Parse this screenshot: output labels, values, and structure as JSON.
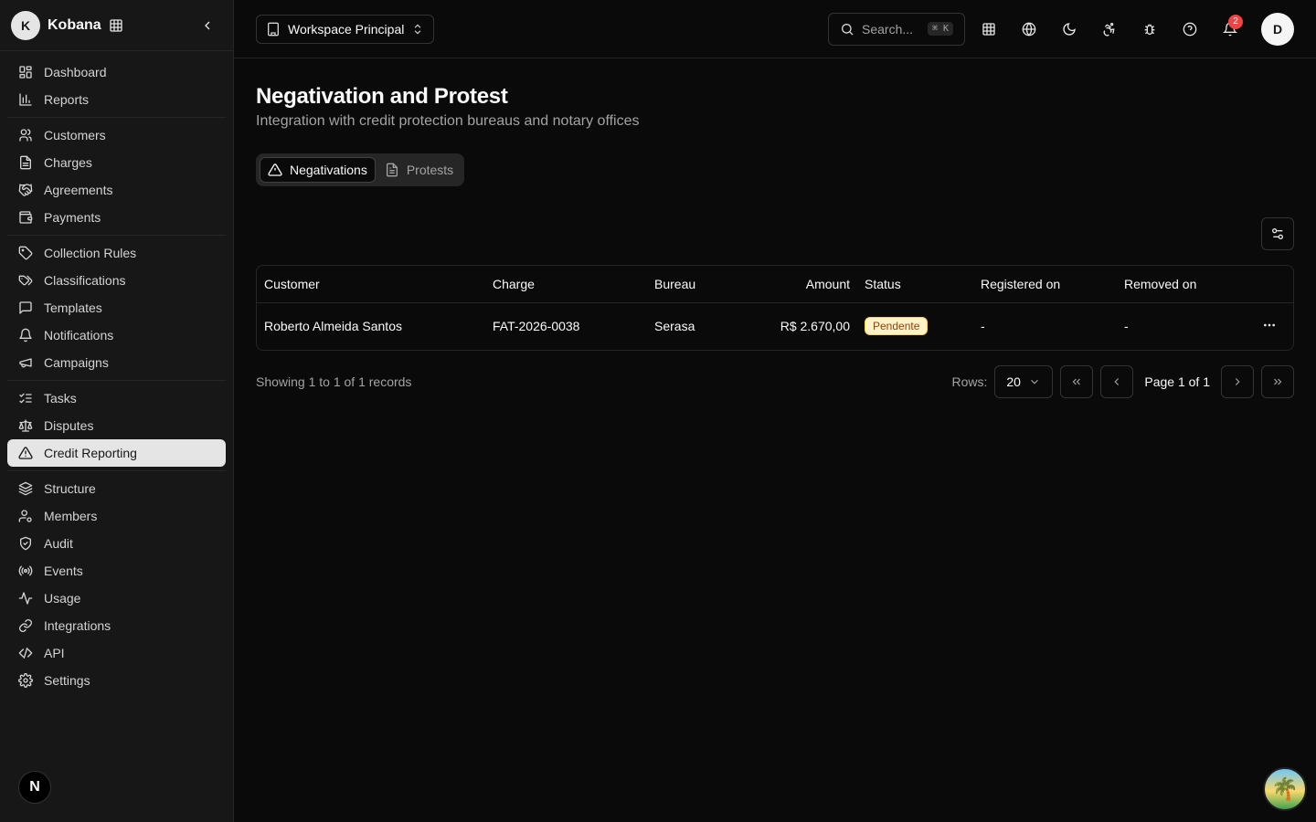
{
  "brand": {
    "initial": "K",
    "name": "Kobana"
  },
  "sidebar": {
    "groups": [
      [
        {
          "label": "Dashboard",
          "icon": "dashboard-icon"
        },
        {
          "label": "Reports",
          "icon": "bar-chart-icon"
        }
      ],
      [
        {
          "label": "Customers",
          "icon": "users-icon"
        },
        {
          "label": "Charges",
          "icon": "file-icon"
        },
        {
          "label": "Agreements",
          "icon": "handshake-icon"
        },
        {
          "label": "Payments",
          "icon": "wallet-icon"
        }
      ],
      [
        {
          "label": "Collection Rules",
          "icon": "tag-icon"
        },
        {
          "label": "Classifications",
          "icon": "tags-icon"
        },
        {
          "label": "Templates",
          "icon": "message-icon"
        },
        {
          "label": "Notifications",
          "icon": "bell-icon"
        },
        {
          "label": "Campaigns",
          "icon": "megaphone-icon"
        }
      ],
      [
        {
          "label": "Tasks",
          "icon": "list-checks-icon"
        },
        {
          "label": "Disputes",
          "icon": "scale-icon"
        },
        {
          "label": "Credit Reporting",
          "icon": "alert-triangle-icon",
          "active": true
        }
      ],
      [
        {
          "label": "Structure",
          "icon": "layers-icon"
        },
        {
          "label": "Members",
          "icon": "user-cog-icon"
        },
        {
          "label": "Audit",
          "icon": "shield-icon"
        },
        {
          "label": "Events",
          "icon": "radio-icon"
        },
        {
          "label": "Usage",
          "icon": "activity-icon"
        },
        {
          "label": "Integrations",
          "icon": "link-icon"
        },
        {
          "label": "API",
          "icon": "code-icon"
        },
        {
          "label": "Settings",
          "icon": "gear-icon"
        }
      ]
    ],
    "footer_badge": "N"
  },
  "topbar": {
    "workspace": "Workspace Principal",
    "search_placeholder": "Search...",
    "search_shortcut": "⌘ K",
    "notification_count": "2",
    "user_initial": "D"
  },
  "page": {
    "title": "Negativation and Protest",
    "subtitle": "Integration with credit protection bureaus and notary offices"
  },
  "tabs": [
    {
      "label": "Negativations",
      "active": true
    },
    {
      "label": "Protests",
      "active": false
    }
  ],
  "table": {
    "headers": [
      "Customer",
      "Charge",
      "Bureau",
      "Amount",
      "Status",
      "Registered on",
      "Removed on"
    ],
    "rows": [
      {
        "customer": "Roberto Almeida Santos",
        "charge": "FAT-2026-0038",
        "bureau": "Serasa",
        "amount": "R$ 2.670,00",
        "status": "Pendente",
        "registered_on": "-",
        "removed_on": "-"
      }
    ]
  },
  "pagination": {
    "summary": "Showing 1 to 1 of 1 records",
    "rows_label": "Rows:",
    "rows_value": "20",
    "page_label": "Page 1 of 1"
  }
}
